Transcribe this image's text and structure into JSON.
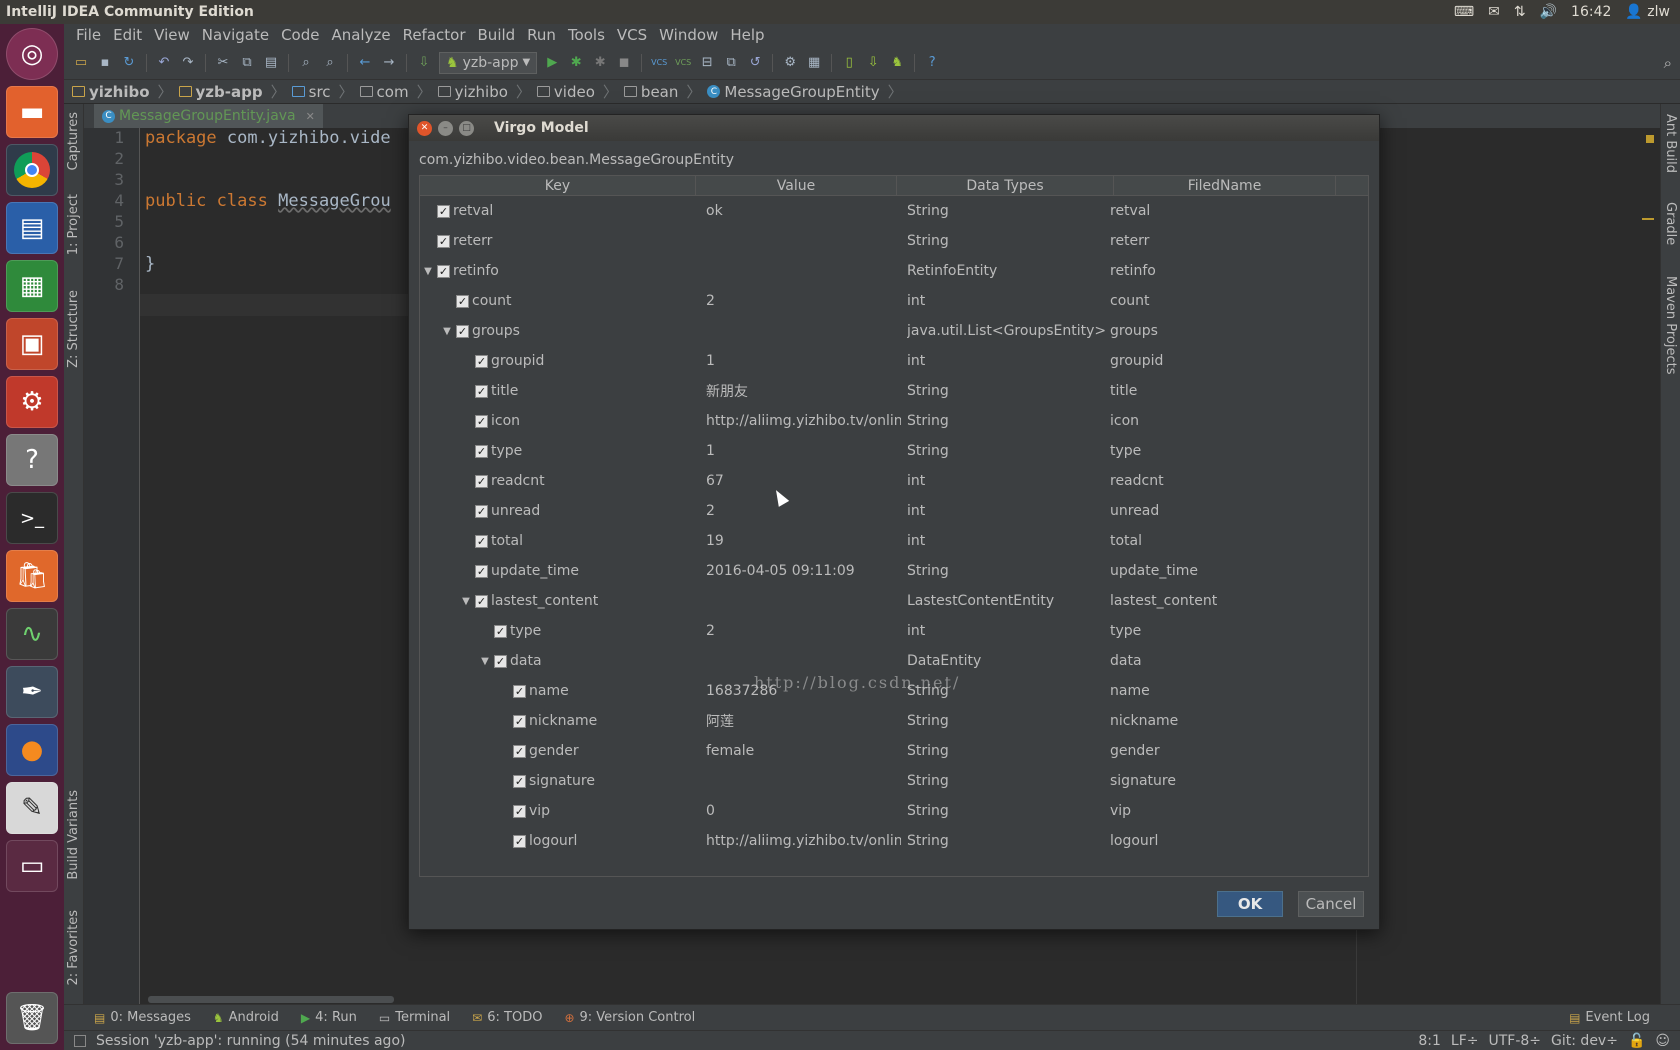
{
  "system": {
    "window_title": "IntelliJ IDEA Community Edition",
    "time": "16:42",
    "user": "zlw",
    "tray_icons": [
      "keyboard-icon",
      "mail-icon",
      "network-icon",
      "volume-icon",
      "user-icon"
    ]
  },
  "launcher": [
    "ubuntu-dash-icon",
    "files-icon",
    "chrome-icon",
    "writer-icon",
    "calc-icon",
    "impress-icon",
    "settings-icon",
    "help-icon",
    "terminal-icon",
    "software-center-icon",
    "system-monitor-icon",
    "intellij-icon",
    "firefox-icon",
    "text-editor-icon",
    "workspace-switcher-icon",
    "trash-icon"
  ],
  "menu": [
    "File",
    "Edit",
    "View",
    "Navigate",
    "Code",
    "Analyze",
    "Refactor",
    "Build",
    "Run",
    "Tools",
    "VCS",
    "Window",
    "Help"
  ],
  "toolbar": {
    "run_config": "yzb-app"
  },
  "breadcrumb": [
    "yizhibo",
    "yzb-app",
    "src",
    "com",
    "yizhibo",
    "video",
    "bean",
    "MessageGroupEntity"
  ],
  "left_tools": [
    "Captures",
    "1: Project",
    "Z: Structure",
    "Build Variants",
    "2: Favorites"
  ],
  "right_tools": [
    "Ant Build",
    "Gradle",
    "Maven Projects"
  ],
  "editor": {
    "tab": "MessageGroupEntity.java",
    "line_numbers": [
      "1",
      "2",
      "3",
      "4",
      "5",
      "6",
      "7",
      "8"
    ],
    "line1_kw": "package",
    "line1_rest": " com.yizhibo.vide",
    "line4_kw1": "public",
    "line4_kw2": " class",
    "line4_cls": "MessageGrou",
    "line7": "}"
  },
  "dialog": {
    "title": "Virgo Model",
    "subtitle": "com.yizhibo.video.bean.MessageGroupEntity",
    "columns": [
      "Key",
      "Value",
      "Data Types",
      "FiledName"
    ],
    "rows": [
      {
        "key": "retval",
        "value": "ok",
        "type": "String",
        "field": "retval"
      },
      {
        "key": "reterr",
        "value": "",
        "type": "String",
        "field": "reterr"
      },
      {
        "key": "retinfo",
        "value": "",
        "type": "RetinfoEntity",
        "field": "retinfo"
      },
      {
        "key": "count",
        "value": "2",
        "type": "int",
        "field": "count"
      },
      {
        "key": "groups",
        "value": "",
        "type": "java.util.List<GroupsEntity>",
        "field": "groups"
      },
      {
        "key": "groupid",
        "value": "1",
        "type": "int",
        "field": "groupid"
      },
      {
        "key": "title",
        "value": "新朋友",
        "type": "String",
        "field": "title"
      },
      {
        "key": "icon",
        "value": "http://aliimg.yizhibo.tv/onlin...",
        "type": "String",
        "field": "icon"
      },
      {
        "key": "type",
        "value": "1",
        "type": "String",
        "field": "type"
      },
      {
        "key": "readcnt",
        "value": "67",
        "type": "int",
        "field": "readcnt"
      },
      {
        "key": "unread",
        "value": "2",
        "type": "int",
        "field": "unread"
      },
      {
        "key": "total",
        "value": "19",
        "type": "int",
        "field": "total"
      },
      {
        "key": "update_time",
        "value": "2016-04-05 09:11:09",
        "type": "String",
        "field": "update_time"
      },
      {
        "key": "lastest_content",
        "value": "",
        "type": "LastestContentEntity",
        "field": "lastest_content"
      },
      {
        "key": "type",
        "value": "2",
        "type": "int",
        "field": "type"
      },
      {
        "key": "data",
        "value": "",
        "type": "DataEntity",
        "field": "data"
      },
      {
        "key": "name",
        "value": "16837286",
        "type": "String",
        "field": "name"
      },
      {
        "key": "nickname",
        "value": "阿莲",
        "type": "String",
        "field": "nickname"
      },
      {
        "key": "gender",
        "value": "female",
        "type": "String",
        "field": "gender"
      },
      {
        "key": "signature",
        "value": "",
        "type": "String",
        "field": "signature"
      },
      {
        "key": "vip",
        "value": "0",
        "type": "String",
        "field": "vip"
      },
      {
        "key": "logourl",
        "value": "http://aliimg.yizhibo.tv/onlin...",
        "type": "String",
        "field": "logourl"
      }
    ],
    "watermark": "http://blog.csdn.net/",
    "ok": "OK",
    "cancel": "Cancel"
  },
  "bottom_tools": [
    "0: Messages",
    "Android",
    "4: Run",
    "Terminal",
    "6: TODO",
    "9: Version Control"
  ],
  "event_log": "Event Log",
  "status": {
    "message": "Session 'yzb-app': running (54 minutes ago)",
    "position": "8:1",
    "line_sep": "LF÷",
    "encoding": "UTF-8÷",
    "vcs": "Git: dev÷"
  }
}
